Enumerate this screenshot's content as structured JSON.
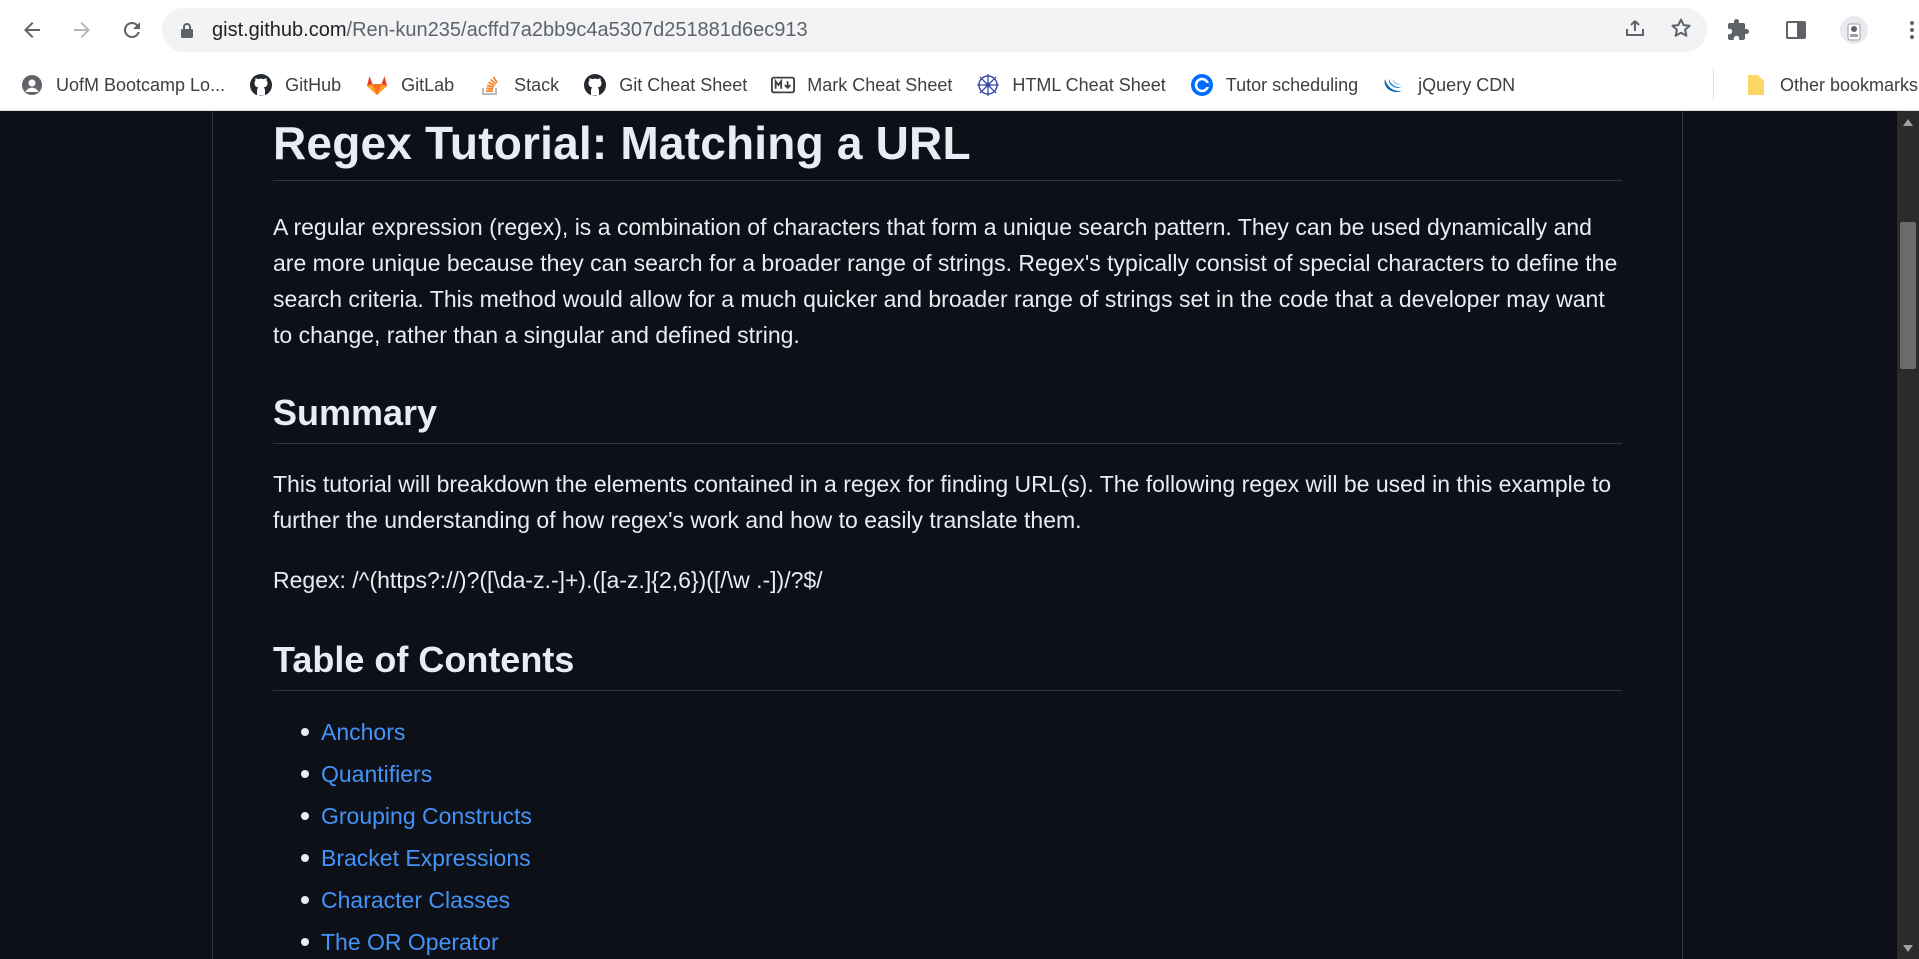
{
  "browser": {
    "url_domain": "gist.github.com",
    "url_path": "/Ren-kun235/acffd7a2bb9c4a5307d251881d6ec913"
  },
  "bookmarks": [
    {
      "label": "UofM Bootcamp Lo...",
      "icon": "globe-icon"
    },
    {
      "label": "GitHub",
      "icon": "github-icon"
    },
    {
      "label": "GitLab",
      "icon": "gitlab-icon"
    },
    {
      "label": "Stack",
      "icon": "stackoverflow-icon"
    },
    {
      "label": "Git Cheat Sheet",
      "icon": "github-icon"
    },
    {
      "label": "Mark Cheat Sheet",
      "icon": "markdown-icon"
    },
    {
      "label": "HTML Cheat Sheet",
      "icon": "compass-icon"
    },
    {
      "label": "Tutor scheduling",
      "icon": "calendly-icon"
    },
    {
      "label": "jQuery CDN",
      "icon": "jquery-icon"
    }
  ],
  "other_bookmarks": "Other bookmarks",
  "article": {
    "title": "Regex Tutorial: Matching a URL",
    "intro": "A regular expression (regex), is a combination of characters that form a unique search pattern. They can be used dynamically and are more unique because they can search for a broader range of strings. Regex's typically consist of special characters to define the search criteria. This method would allow for a much quicker and broader range of strings set in the code that a developer may want to change, rather than a singular and defined string.",
    "summary_heading": "Summary",
    "summary_text": "This tutorial will breakdown the elements contained in a regex for finding URL(s). The following regex will be used in this example to further the understanding of how regex's work and how to easily translate them.",
    "regex_line": "Regex: /^(https?://)?([\\da-z.-]+).([a-z.]{2,6})([/\\w .-])/?$/",
    "toc_heading": "Table of Contents",
    "toc": [
      "Anchors",
      "Quantifiers",
      "Grouping Constructs",
      "Bracket Expressions",
      "Character Classes",
      "The OR Operator"
    ]
  },
  "colors": {
    "page_bg": "#0d1117",
    "text": "#e6edf3",
    "link": "#4493f8",
    "border": "#30363d"
  }
}
